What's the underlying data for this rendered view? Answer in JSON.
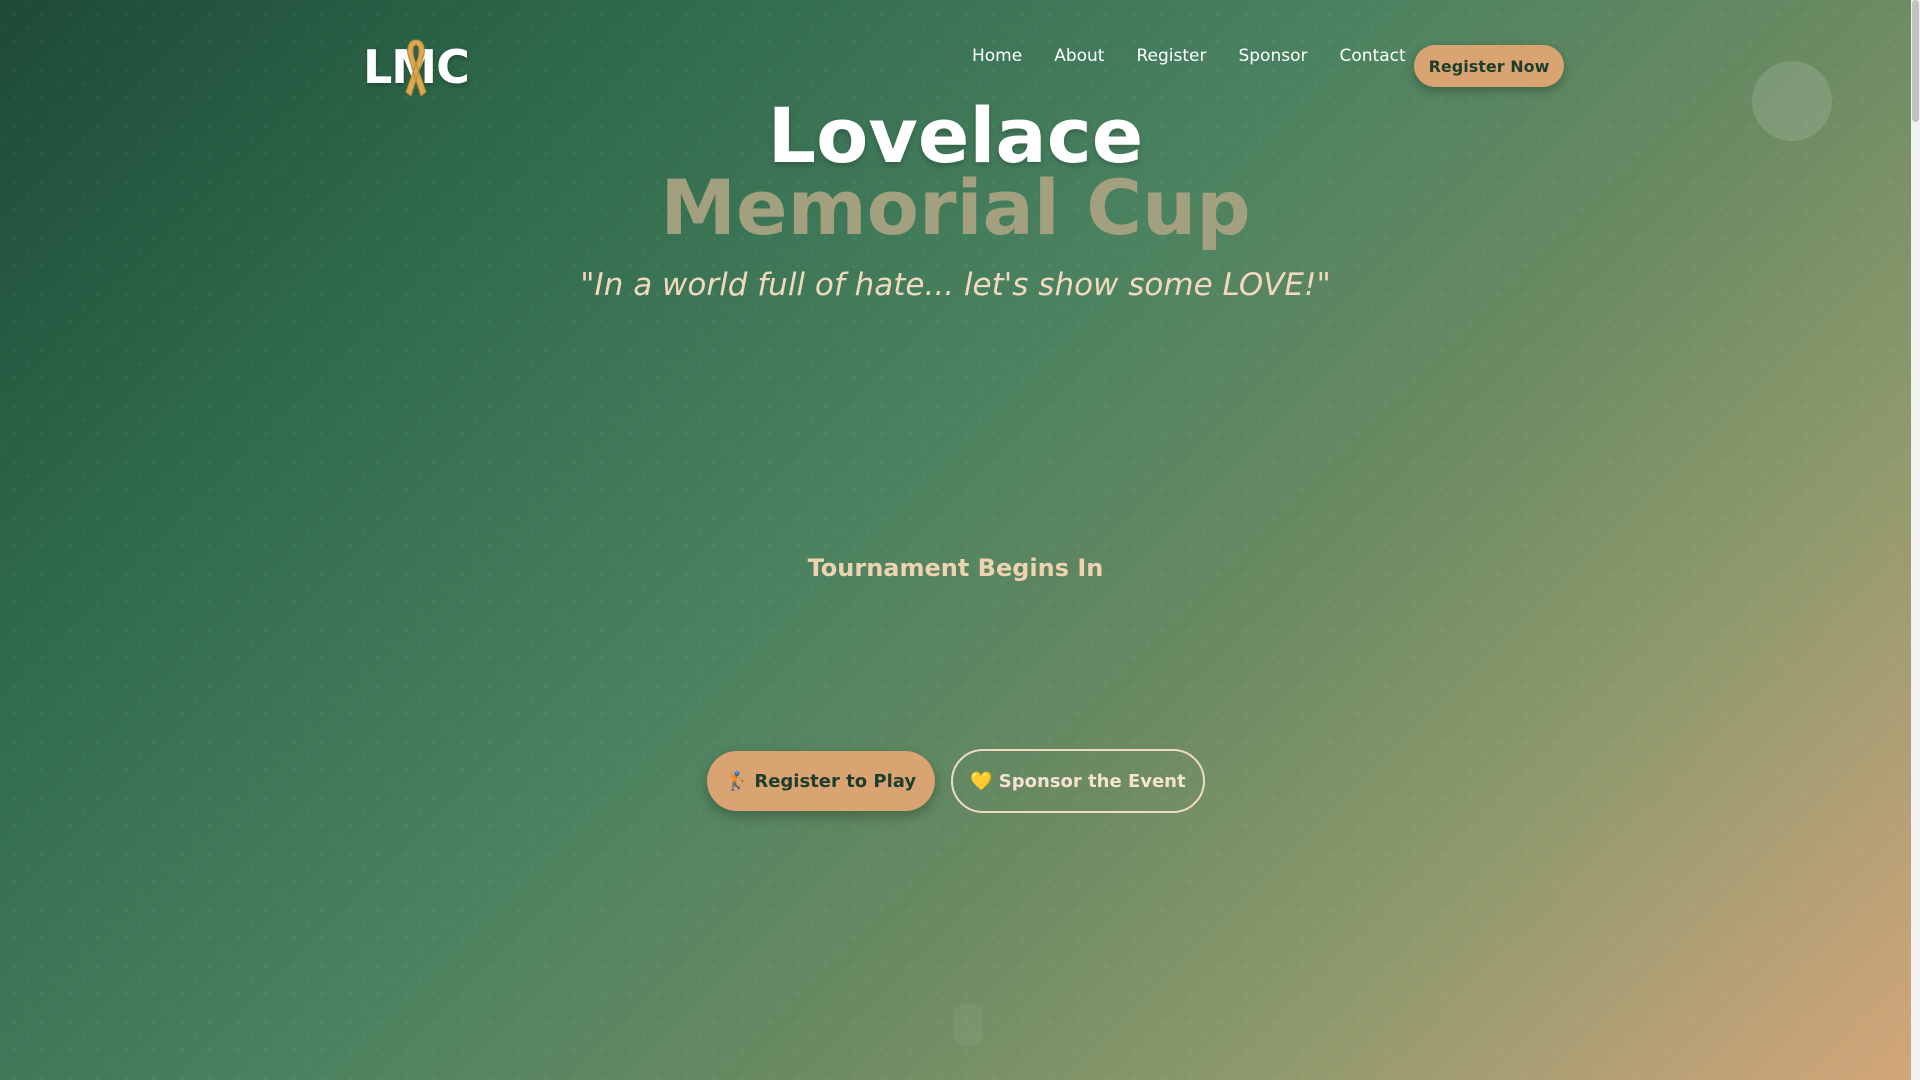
{
  "header": {
    "logo_text": "LMC",
    "nav": [
      {
        "label": "Home"
      },
      {
        "label": "About"
      },
      {
        "label": "Register"
      },
      {
        "label": "Sponsor"
      },
      {
        "label": "Contact"
      }
    ],
    "cta_label": "Register Now"
  },
  "hero": {
    "title_line1": "Lovelace",
    "title_line2": "Memorial Cup",
    "tagline": "\"In a world full of hate... let's show some LOVE!\"",
    "countdown_label": "Tournament Begins In",
    "buttons": {
      "primary": {
        "icon": "🏌️",
        "label": "Register to Play"
      },
      "secondary": {
        "icon": "💛",
        "label": "Sponsor the Event"
      }
    }
  },
  "colors": {
    "accent": "#d9a472",
    "title_secondary": "#a3a080",
    "tagline": "#f2d9bd",
    "gradient_start": "#1e4a38",
    "gradient_end": "#d3a678"
  },
  "icons": {
    "logo": "awareness-ribbon-icon",
    "scroll": "scroll-indicator-icon"
  }
}
